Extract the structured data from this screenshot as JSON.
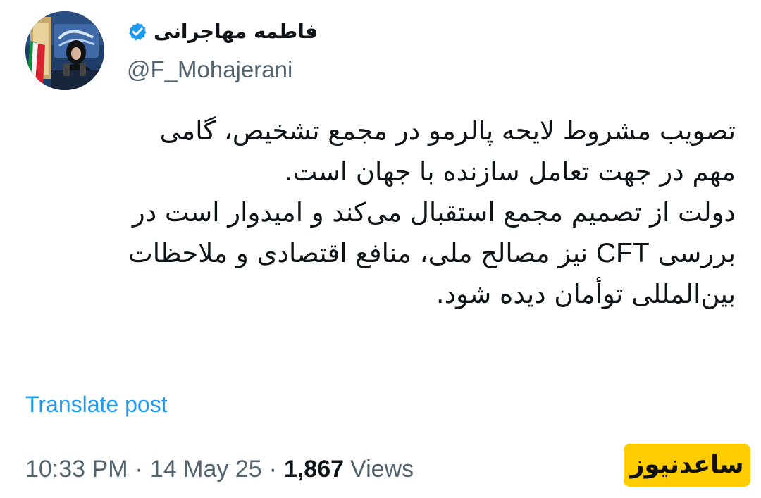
{
  "author": {
    "display_name": "فاطمه مهاجرانی",
    "handle": "@F_Mohajerani",
    "verified_badge_color": "#1d9bf0",
    "verified_badge_icon": "verified-check-icon"
  },
  "tweet": {
    "lines": [
      {
        "text": "تصویب مشروط لایحه پالرمو در مجمع تشخیص، گامی"
      },
      {
        "text": "مهم در جهت تعامل سازنده با جهان است."
      },
      {
        "text": "دولت از تصمیم مجمع استقبال می‌کند و امیدوار است در"
      },
      {
        "before": "بررسی ",
        "ltr": "CFT",
        "after": " نیز مصالح ملی، منافع اقتصادی و ملاحظات"
      },
      {
        "text": "بین‌المللی توأمان دیده شود."
      }
    ]
  },
  "actions": {
    "translate_label": "Translate post"
  },
  "meta": {
    "time": "10:33 PM",
    "separator": "·",
    "date": "14 May 25",
    "views_count": "1,867",
    "views_label": "Views"
  },
  "watermark": {
    "text": "ساعدنیوز",
    "background_color": "#ffcc00"
  },
  "colors": {
    "accent": "#1d9bf0",
    "text": "#0f1419",
    "muted": "#536471"
  }
}
